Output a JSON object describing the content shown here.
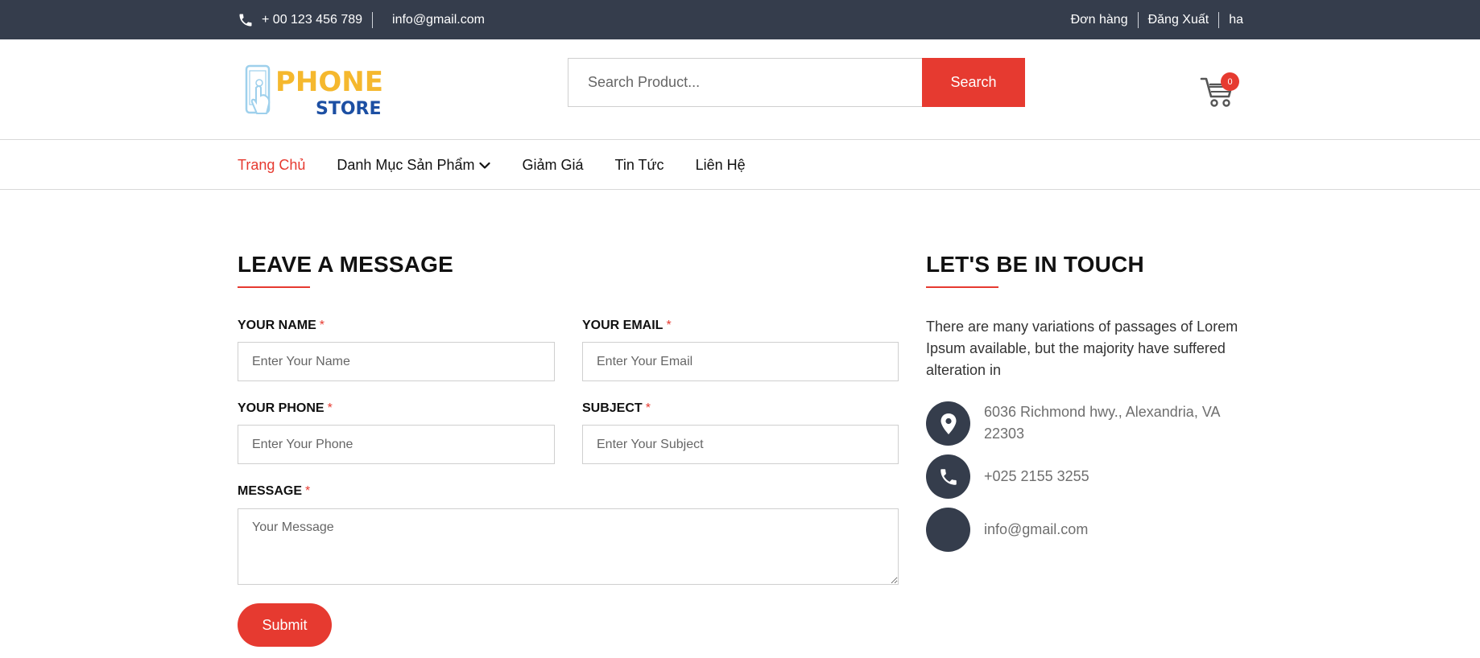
{
  "topbar": {
    "phone": "+ 00 123 456 789",
    "email": "info@gmail.com",
    "orders": "Đơn hàng",
    "logout": "Đăng Xuất",
    "user": "ha"
  },
  "header": {
    "logo_line1": "PHONE",
    "logo_line2": "STORE",
    "search_placeholder": "Search Product...",
    "search_button": "Search",
    "cart_count": "0"
  },
  "nav": {
    "items": [
      {
        "label": "Trang Chủ"
      },
      {
        "label": "Danh Mục Sản Phẩm"
      },
      {
        "label": "Giảm Giá"
      },
      {
        "label": "Tin Tức"
      },
      {
        "label": "Liên Hệ"
      }
    ]
  },
  "form": {
    "title": "LEAVE A MESSAGE",
    "name_label": "YOUR NAME",
    "name_placeholder": "Enter Your Name",
    "email_label": "YOUR EMAIL",
    "email_placeholder": "Enter Your Email",
    "phone_label": "YOUR PHONE",
    "phone_placeholder": "Enter Your Phone",
    "subject_label": "SUBJECT",
    "subject_placeholder": "Enter Your Subject",
    "message_label": "MESSAGE",
    "message_placeholder": "Your Message",
    "required_mark": "*",
    "submit": "Submit"
  },
  "contact": {
    "title": "LET'S BE IN TOUCH",
    "intro": "There are many variations of passages of Lorem Ipsum available, but the majority have suffered alteration in",
    "address": "6036 Richmond hwy., Alexandria, VA 22303",
    "phone": "+025 2155 3255",
    "email": "info@gmail.com"
  },
  "colors": {
    "accent": "#e63a30",
    "dark": "#353d4c",
    "logo_yellow": "#f5b82e",
    "logo_blue": "#1c4fa3"
  }
}
